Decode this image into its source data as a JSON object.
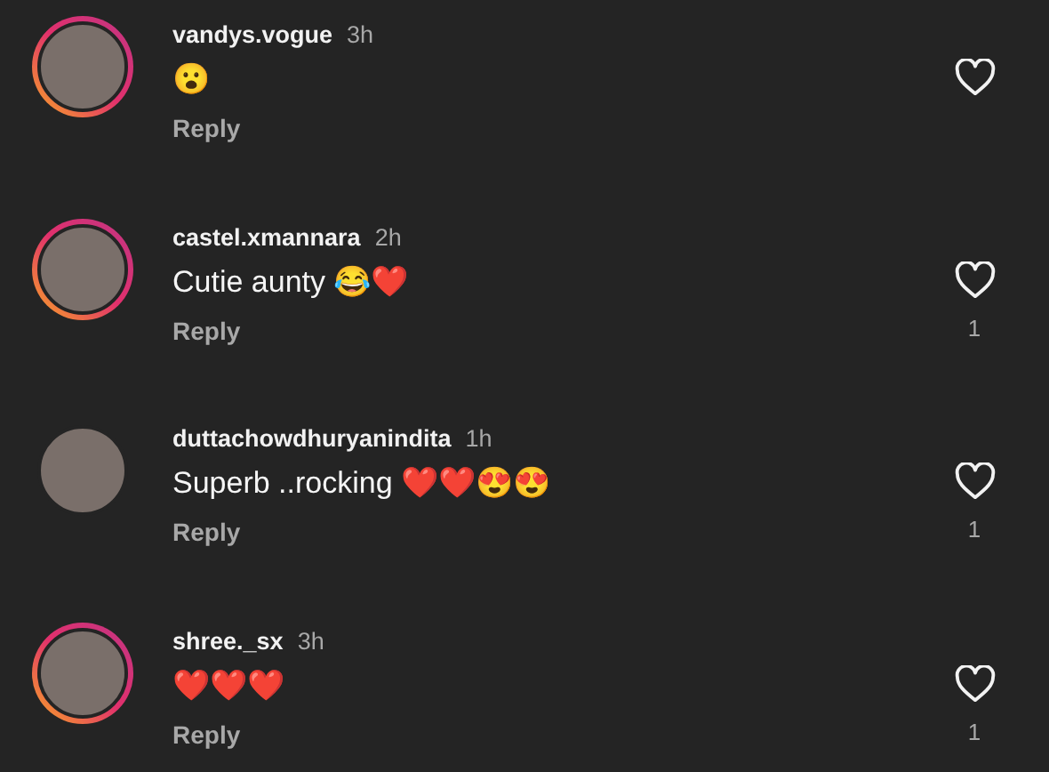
{
  "comments": [
    {
      "username": "vandys.vogue",
      "time": "3h",
      "text": "😮",
      "reply": "Reply",
      "story_ring": true
    },
    {
      "username": "castel.xmannara",
      "time": "2h",
      "text": "Cutie aunty 😂❤️",
      "reply": "Reply",
      "story_ring": true,
      "likes": "1"
    },
    {
      "username": "duttachowdhuryanindita",
      "time": "1h",
      "text": "Superb ..rocking ❤️❤️😍😍",
      "reply": "Reply",
      "story_ring": false,
      "likes": "1"
    },
    {
      "username": "shree._sx",
      "time": "3h",
      "text": "❤️❤️❤️",
      "reply": "Reply",
      "story_ring": true,
      "likes": "1"
    }
  ]
}
